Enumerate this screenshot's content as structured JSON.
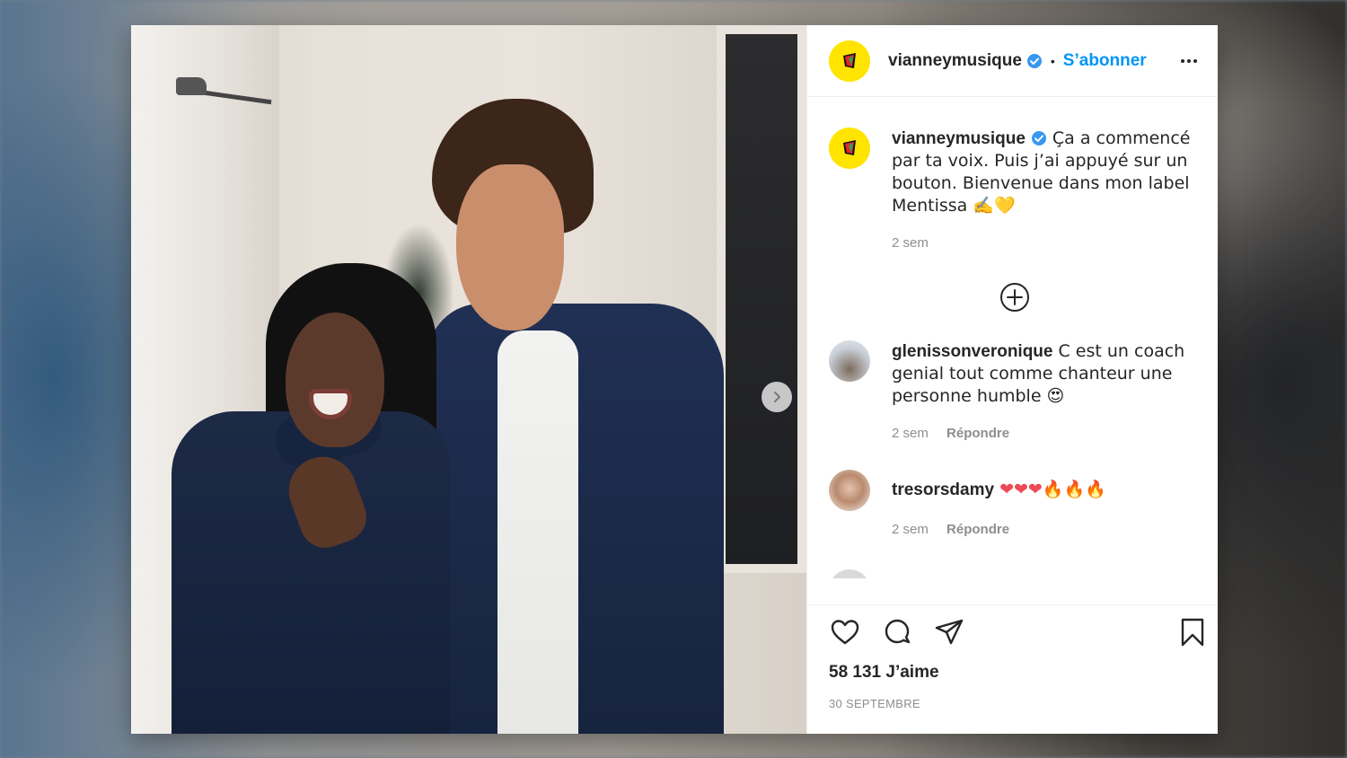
{
  "post": {
    "account": {
      "username": "vianneymusique",
      "verified": true,
      "follow_label": "S’abonner",
      "separator": "•"
    },
    "caption": {
      "username": "vianneymusique",
      "text": "Ça a commencé par ta voix. Puis j’ai appuyé sur un bouton. Bienvenue dans mon label Mentissa ✍️💛",
      "time": "2 sem"
    },
    "comments": [
      {
        "username": "glenissonveronique",
        "text": "C est un coach genial tout comme chanteur une personne humble 😍",
        "time": "2 sem",
        "reply_label": "Répondre"
      },
      {
        "username": "tresorsdamy",
        "text": "❤❤❤🔥🔥🔥",
        "time": "2 sem",
        "reply_label": "Répondre"
      }
    ],
    "likes": "58 131 J’aime",
    "date": "30 SEPTEMBRE"
  },
  "colors": {
    "accent_blue": "#0095f6",
    "verified_blue": "#3897f0",
    "avatar_yellow": "#ffe400",
    "text": "#262626",
    "muted": "#8e8e8e"
  },
  "icons": [
    "verified-icon",
    "more-icon",
    "add-comment-icon",
    "next-icon",
    "like-icon",
    "comment-icon",
    "share-icon",
    "save-icon"
  ]
}
